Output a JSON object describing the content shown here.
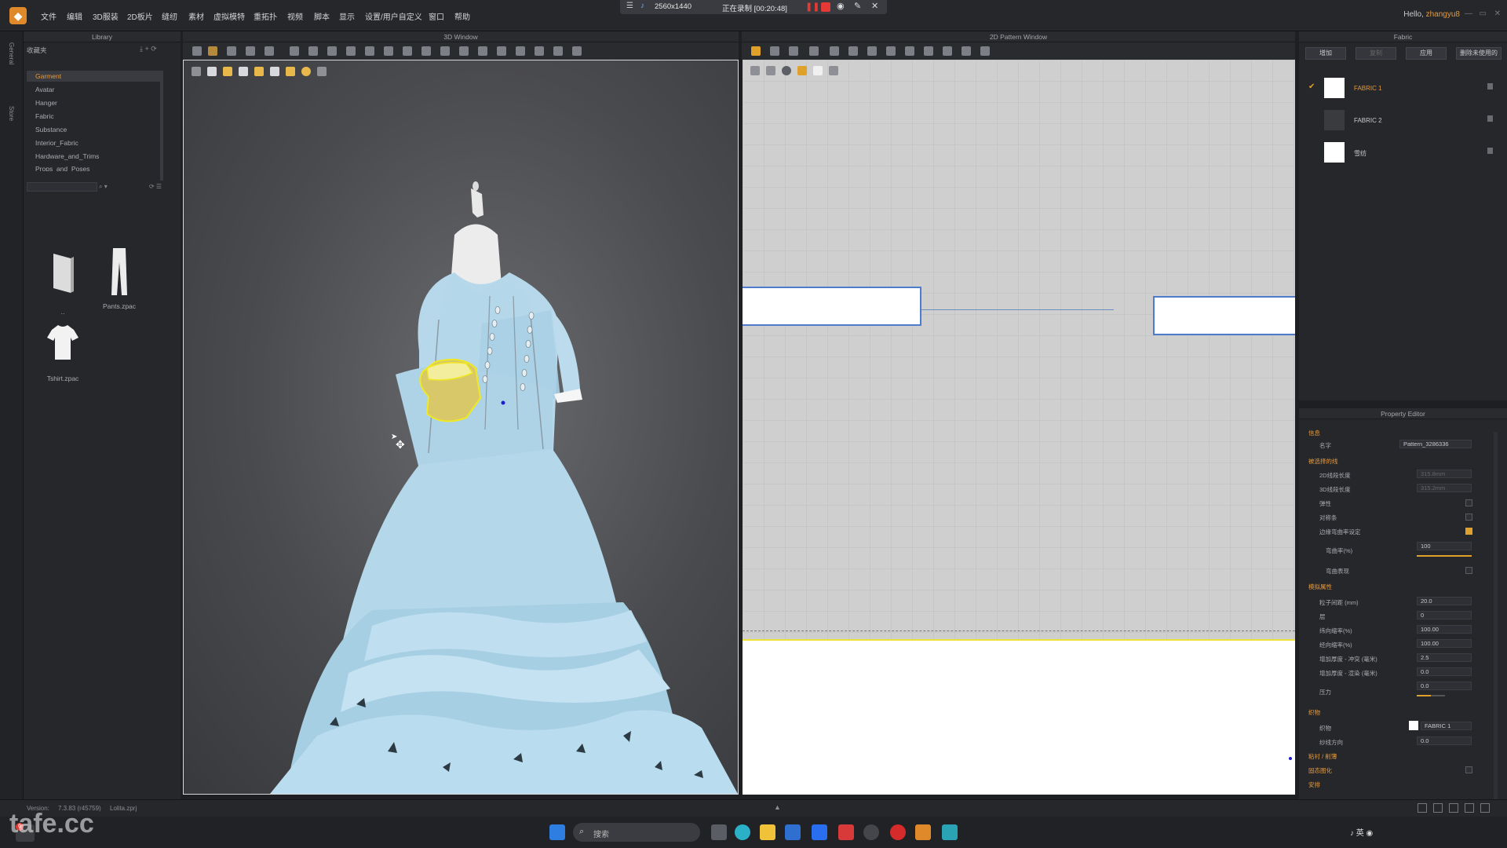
{
  "menubar": {
    "items": [
      "文件",
      "编辑",
      "3D服装",
      "2D板片",
      "缝纫",
      "素材",
      "虚拟模特",
      "重拓扑",
      "视频",
      "脚本",
      "显示",
      "设置/用户自定义",
      "窗口",
      "帮助"
    ],
    "hello_label": "Hello,",
    "username": "zhangyu8"
  },
  "recording": {
    "resolution": "2560x1440",
    "status": "正在录制 [00:20:48]"
  },
  "left_strip": {
    "tab1": "General",
    "tab2": "Store"
  },
  "library": {
    "title": "Library",
    "favorites_label": "收藏夹",
    "categories": [
      "Garment",
      "Avatar",
      "Hanger",
      "Fabric",
      "Substance",
      "Interior_Fabric",
      "Hardware_and_Trims",
      "Props_and_Poses"
    ],
    "files": [
      {
        "label": "..",
        "icon": "folder-up-icon"
      },
      {
        "label": "Pants.zpac",
        "icon": "pants-icon"
      },
      {
        "label": "Tshirt.zpac",
        "icon": "tshirt-icon"
      }
    ]
  },
  "window3d": {
    "title": "3D Window"
  },
  "window2d": {
    "title": "2D Pattern Window"
  },
  "fabric_panel": {
    "title": "Fabric",
    "buttons": [
      "增加",
      "复制",
      "应用",
      "删除未使用的"
    ],
    "fabrics": [
      {
        "name": "FABRIC 1",
        "checked": true,
        "color": "#ffffff"
      },
      {
        "name": "FABRIC 2",
        "checked": false,
        "color": "#3a3b3f"
      },
      {
        "name": "雪纺",
        "checked": false,
        "color": "#ffffff"
      }
    ]
  },
  "property_editor": {
    "title": "Property Editor",
    "sections": {
      "info": "信息",
      "name_label": "名字",
      "name_value": "Pattern_3286336",
      "selected_line": "被选择的线",
      "len2d_label": "2D线段长度",
      "len2d_value": "315.8mm",
      "len3d_label": "3D线段长度",
      "len3d_value": "315.2mm",
      "curve_label": "弹性",
      "symmetric_label": "对称条",
      "override_label": "边缘弯曲率设定",
      "bend_label": "弯曲率(%)",
      "bend_value": "100",
      "show_label": "弯曲表现",
      "sim_section": "模拟属性",
      "particle_label": "粒子间距 (mm)",
      "particle_value": "20.0",
      "layer_label": "层",
      "layer_value": "0",
      "shrinkw_label": "纬向缩率(%)",
      "shrinkw_value": "100.00",
      "shrinkh_label": "经向缩率(%)",
      "shrinkh_value": "100.00",
      "thick_col_label": "增加厚度 - 冲突 (毫米)",
      "thick_col_value": "2.5",
      "thick_ren_label": "增加厚度 - 渲染 (毫米)",
      "thick_ren_value": "0.0",
      "pressure_label": "压力",
      "pressure_value": "0.0",
      "material_section": "织物",
      "fabric_label": "织物",
      "fabric_value": "FABRIC 1",
      "grain_label": "纱线方向",
      "grain_value": "0.0",
      "tag_section": "粘衬 / 削薄",
      "solidify_section": "固态图化",
      "arrange_section": "安排"
    },
    "bend_level": 1.0,
    "pressure_level": 0.5
  },
  "statusbar": {
    "version_label": "Version:",
    "version_value": "7.3.83 (r45759)",
    "file_name": "Lolita.zprj"
  },
  "taskbar": {
    "search_placeholder": "搜索",
    "badge": "6"
  },
  "watermark": "tafe.cc"
}
